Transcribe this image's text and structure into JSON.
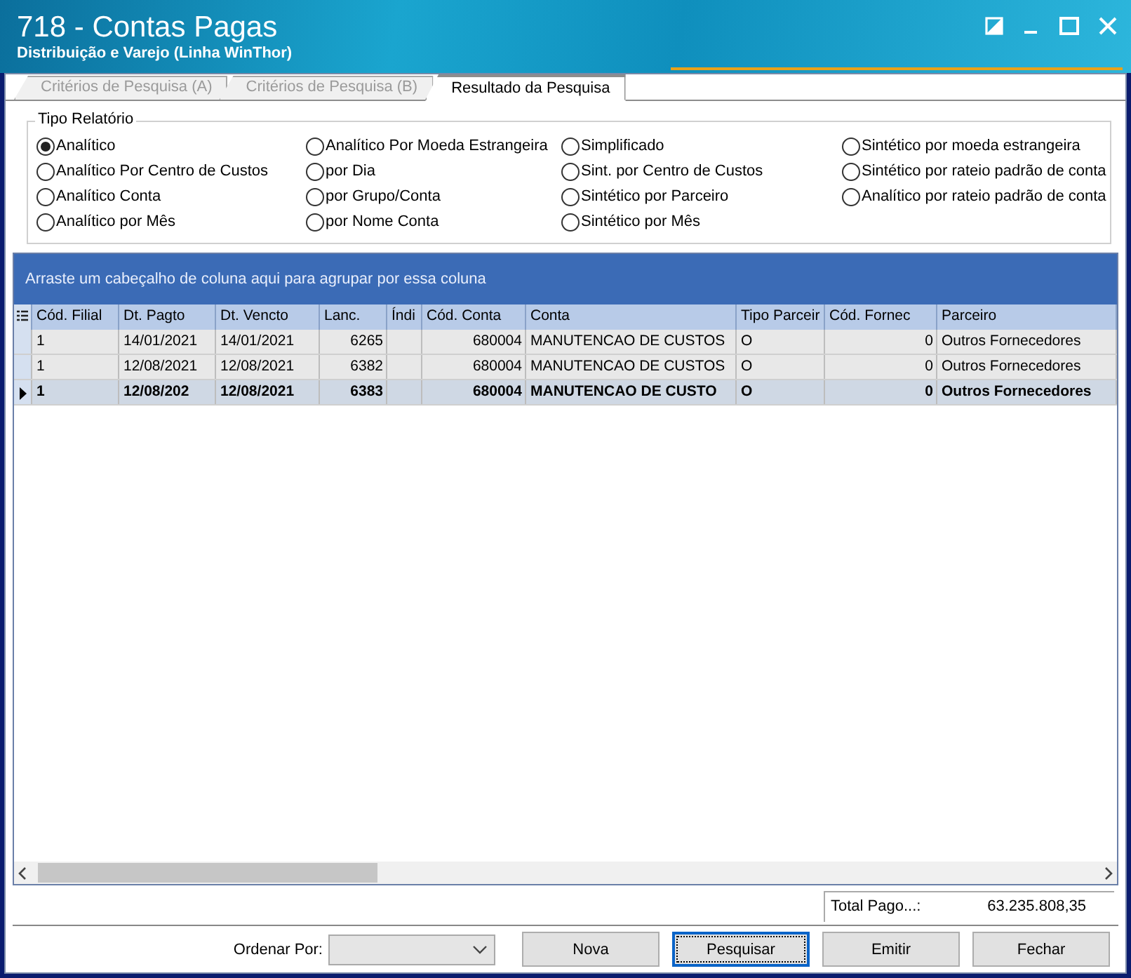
{
  "window": {
    "title": "718 - Contas Pagas",
    "subtitle": "Distribuição e Varejo (Linha WinThor)"
  },
  "tabs": [
    {
      "label": "Critérios de Pesquisa (A)",
      "selected": false
    },
    {
      "label": "Critérios de Pesquisa (B)",
      "selected": false
    },
    {
      "label": "Resultado da Pesquisa",
      "selected": true
    }
  ],
  "report_type": {
    "title": "Tipo Relatório",
    "columns": [
      [
        {
          "label": "Analítico",
          "selected": true
        },
        {
          "label": "Analítico Por Centro de Custos",
          "selected": false
        },
        {
          "label": "Analítico Conta",
          "selected": false
        },
        {
          "label": "Analítico por Mês",
          "selected": false
        }
      ],
      [
        {
          "label": "Analítico Por Moeda Estrangeira",
          "selected": false
        },
        {
          "label": "por Dia",
          "selected": false
        },
        {
          "label": "por Grupo/Conta",
          "selected": false
        },
        {
          "label": "por Nome Conta",
          "selected": false
        }
      ],
      [
        {
          "label": "Simplificado",
          "selected": false
        },
        {
          "label": "Sint. por Centro de Custos",
          "selected": false
        },
        {
          "label": "Sintético por Parceiro",
          "selected": false
        },
        {
          "label": "Sintético por Mês",
          "selected": false
        }
      ],
      [
        {
          "label": "Sintético por moeda estrangeira",
          "selected": false
        },
        {
          "label": "Sintético por rateio padrão de conta",
          "selected": false
        },
        {
          "label": "Analítico por rateio padrão de conta",
          "selected": false
        }
      ]
    ]
  },
  "grid": {
    "group_panel": "Arraste um cabeçalho de coluna aqui para agrupar por essa coluna",
    "columns": [
      "Cód. Filial",
      "Dt. Pagto",
      "Dt. Vencto",
      "Lanc.",
      "Índi",
      "Cód. Conta",
      "Conta",
      "Tipo Parceir",
      "Cód. Fornec",
      "Parceiro"
    ],
    "rows": [
      {
        "selected": false,
        "cells": [
          "1",
          "14/01/2021",
          "14/01/2021",
          "6265",
          "",
          "680004",
          "MANUTENCAO DE CUSTOS",
          "O",
          "0",
          "Outros Fornecedores"
        ]
      },
      {
        "selected": false,
        "cells": [
          "1",
          "12/08/2021",
          "12/08/2021",
          "6382",
          "",
          "680004",
          "MANUTENCAO DE CUSTOS",
          "O",
          "0",
          "Outros Fornecedores"
        ]
      },
      {
        "selected": true,
        "cells": [
          "1",
          "12/08/202",
          "12/08/2021",
          "6383",
          "",
          "680004",
          "MANUTENCAO DE CUSTO",
          "O",
          "0",
          "Outros Fornecedores"
        ]
      }
    ]
  },
  "total": {
    "label": "Total Pago...:",
    "value": "63.235.808,35"
  },
  "footer": {
    "order_label": "Ordenar Por:",
    "buttons": [
      {
        "label": "Nova",
        "focused": false
      },
      {
        "label": "Pesquisar",
        "focused": true
      },
      {
        "label": "Emitir",
        "focused": false
      },
      {
        "label": "Fechar",
        "focused": false
      }
    ]
  }
}
